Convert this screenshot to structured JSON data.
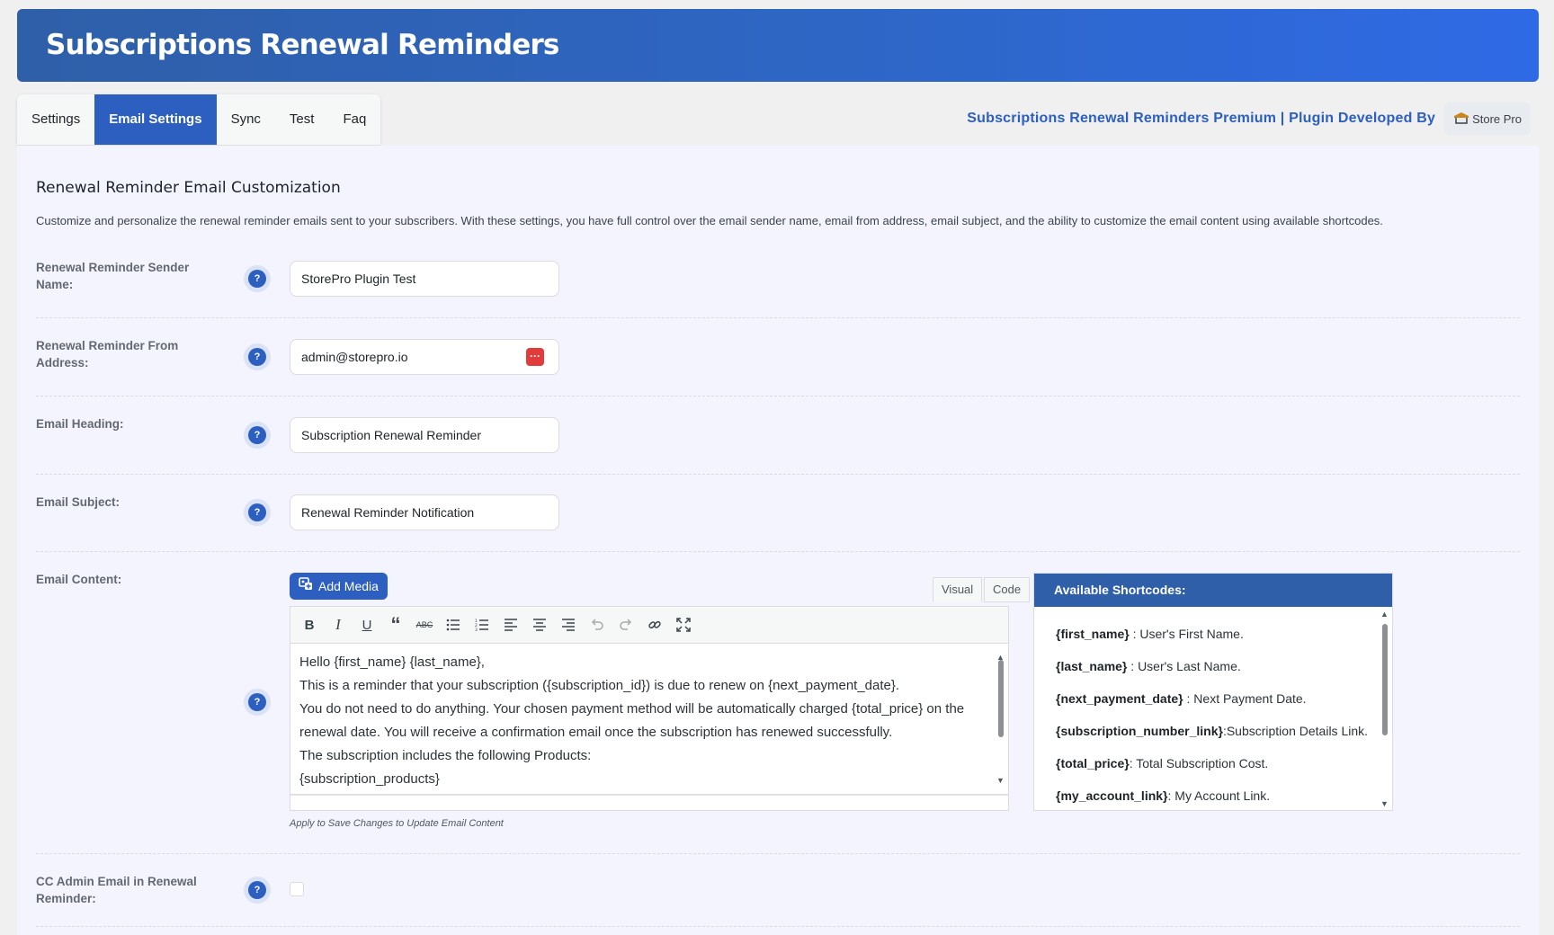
{
  "header": {
    "title": "Subscriptions Renewal Reminders"
  },
  "tabs": [
    {
      "label": "Settings",
      "active": false
    },
    {
      "label": "Email Settings",
      "active": true
    },
    {
      "label": "Sync",
      "active": false
    },
    {
      "label": "Test",
      "active": false
    },
    {
      "label": "Faq",
      "active": false
    }
  ],
  "developer": {
    "text": "Subscriptions Renewal Reminders Premium | Plugin Developed By",
    "logo_text": "Store Pro",
    "logo_icon": "storepro-logo-icon"
  },
  "section": {
    "title": "Renewal Reminder Email Customization",
    "description": "Customize and personalize the renewal reminder emails sent to your subscribers. With these settings, you have full control over the email sender name, email from address, email subject, and the ability to customize the email content using available shortcodes."
  },
  "fields": {
    "sender_name": {
      "label": "Renewal Reminder Sender Name:",
      "value": "StorePro Plugin Test"
    },
    "from_address": {
      "label": "Renewal Reminder From Address:",
      "value": "admin@storepro.io"
    },
    "email_heading": {
      "label": "Email Heading:",
      "value": "Subscription Renewal Reminder"
    },
    "email_subject": {
      "label": "Email Subject:",
      "value": "Renewal Reminder Notification"
    },
    "email_content": {
      "label": "Email Content:"
    },
    "cc_admin": {
      "label": "CC Admin Email in Renewal Reminder:",
      "checked": false
    }
  },
  "help_symbol": "?",
  "editor": {
    "add_media_label": "Add Media",
    "visual_tab": "Visual",
    "code_tab": "Code",
    "active_tab": "Visual",
    "toolbar_icons": [
      "bold-icon",
      "italic-icon",
      "underline-icon",
      "blockquote-icon",
      "strikethrough-icon",
      "bullet-list-icon",
      "numbered-list-icon",
      "align-left-icon",
      "align-center-icon",
      "align-right-icon",
      "undo-icon",
      "redo-icon",
      "link-icon",
      "fullscreen-icon"
    ],
    "content_lines": [
      "Hello {first_name} {last_name},",
      "This is a reminder that your subscription ({subscription_id}) is due to renew on {next_payment_date}.",
      "You do not need to do anything. Your chosen payment method will be automatically charged {total_price} on the renewal date. You will receive a confirmation email once the subscription has renewed successfully.",
      "The subscription includes the following Products:",
      "{subscription_products}"
    ],
    "apply_note": "Apply to Save Changes to Update Email Content"
  },
  "shortcodes": {
    "title": "Available Shortcodes:",
    "items": [
      {
        "code": "{first_name}",
        "sep": " : ",
        "desc": "User's First Name."
      },
      {
        "code": "{last_name}",
        "sep": " : ",
        "desc": "User's Last Name."
      },
      {
        "code": "{next_payment_date}",
        "sep": " : ",
        "desc": "Next Payment Date."
      },
      {
        "code": "{subscription_number_link}",
        "sep": ":",
        "desc": "Subscription Details Link."
      },
      {
        "code": "{total_price}",
        "sep": ": ",
        "desc": "Total Subscription Cost."
      },
      {
        "code": "{my_account_link}",
        "sep": ": ",
        "desc": "My Account Link."
      }
    ]
  },
  "colors": {
    "header_gradient_start": "#2f5fa8",
    "header_gradient_end": "#2f6ae6",
    "accent": "#2c5fbf",
    "panel_bg": "#f3f4ff",
    "password_icon": "#e23b3b"
  }
}
